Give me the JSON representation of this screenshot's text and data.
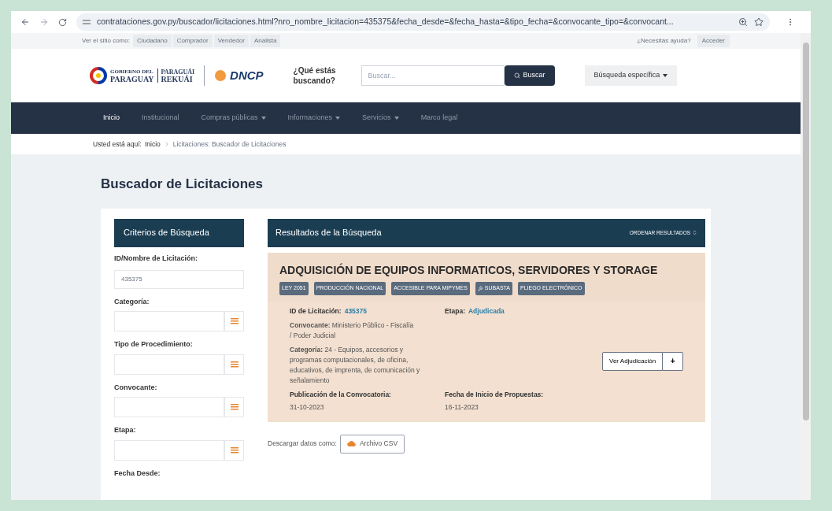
{
  "browser": {
    "url": "contrataciones.gov.py/buscador/licitaciones.html?nro_nombre_licitacion=435375&fecha_desde=&fecha_hasta=&tipo_fecha=&convocante_tipo=&convocant..."
  },
  "top_bar": {
    "view_as": "Ver el sitio como:",
    "roles": [
      "Ciudadano",
      "Comprador",
      "Vendedor",
      "Analista"
    ],
    "help": "¿Necesitás ayuda?",
    "login": "Acceder"
  },
  "header": {
    "gov_logo": [
      "GOBIERNO DEL",
      "PARAGUAY",
      "PARAGUÁI",
      "REKUÁI"
    ],
    "dncp_logo": "DNCP",
    "search_prompt": "¿Qué estás buscando?",
    "search": {
      "placeholder": "Buscar..."
    },
    "search_button": "Buscar",
    "specific_search": "Búsqueda específica"
  },
  "nav": [
    {
      "label": "Inicio",
      "selected": true,
      "dropdown": false
    },
    {
      "label": "Institucional",
      "selected": false,
      "dropdown": false
    },
    {
      "label": "Compras públicas",
      "selected": false,
      "dropdown": true
    },
    {
      "label": "Informaciones",
      "selected": false,
      "dropdown": true
    },
    {
      "label": "Servicios",
      "selected": false,
      "dropdown": true
    },
    {
      "label": "Marco legal",
      "selected": false,
      "dropdown": false
    }
  ],
  "breadcrumb": {
    "prefix": "Usted está aquí:",
    "items": [
      "Inicio",
      "Licitaciones: Buscador de Licitaciones"
    ]
  },
  "page_title": "Buscador de Licitaciones",
  "filters": {
    "title": "Criterios de Búsqueda",
    "fields": [
      {
        "label": "ID/Nombre de Licitación:",
        "kind": "text",
        "value": "435375"
      },
      {
        "label": "Categoría:",
        "kind": "picker"
      },
      {
        "label": "Tipo de Procedimiento:",
        "kind": "picker"
      },
      {
        "label": "Convocante:",
        "kind": "picker"
      },
      {
        "label": "Etapa:",
        "kind": "picker"
      },
      {
        "label": "Fecha Desde:",
        "kind": "label"
      }
    ]
  },
  "results": {
    "title": "Resultados de la Búsqueda",
    "sort": "ORDENAR RESULTADOS",
    "item": {
      "title": "ADQUISICIÓN DE EQUIPOS INFORMATICOS, SERVIDORES Y STORAGE",
      "tags": [
        {
          "label": "LEY 2051",
          "icon": false
        },
        {
          "label": "PRODUCCIÓN NACIONAL",
          "icon": false
        },
        {
          "label": "ACCESIBLE PARA MIPYMES",
          "icon": false
        },
        {
          "label": "SUBASTA",
          "icon": true
        },
        {
          "label": "PLIEGO ELECTRÓNICO",
          "icon": false
        }
      ],
      "id_label": "ID de Licitación:",
      "id_value": "435375",
      "stage_label": "Etapa:",
      "stage_value": "Adjudicada",
      "convener": "**Convocante:** Ministerio Público - Fiscalía / Poder Judicial",
      "category": "**Categoría:** 24 - Equipos, accesorios y programas computacionales, de oficina, educativos, de imprenta, de comunicación y señalamiento",
      "publication_label": "Publicación de la Convocatoria:",
      "publication_date": "31-10-2023",
      "start_label": "Fecha de Inicio de Propuestas:",
      "start_date": "16-11-2023",
      "award_button": "Ver Adjudicación",
      "more_button": "+"
    }
  },
  "download": {
    "label": "Descargar datos como:",
    "button": "Archivo CSV"
  }
}
